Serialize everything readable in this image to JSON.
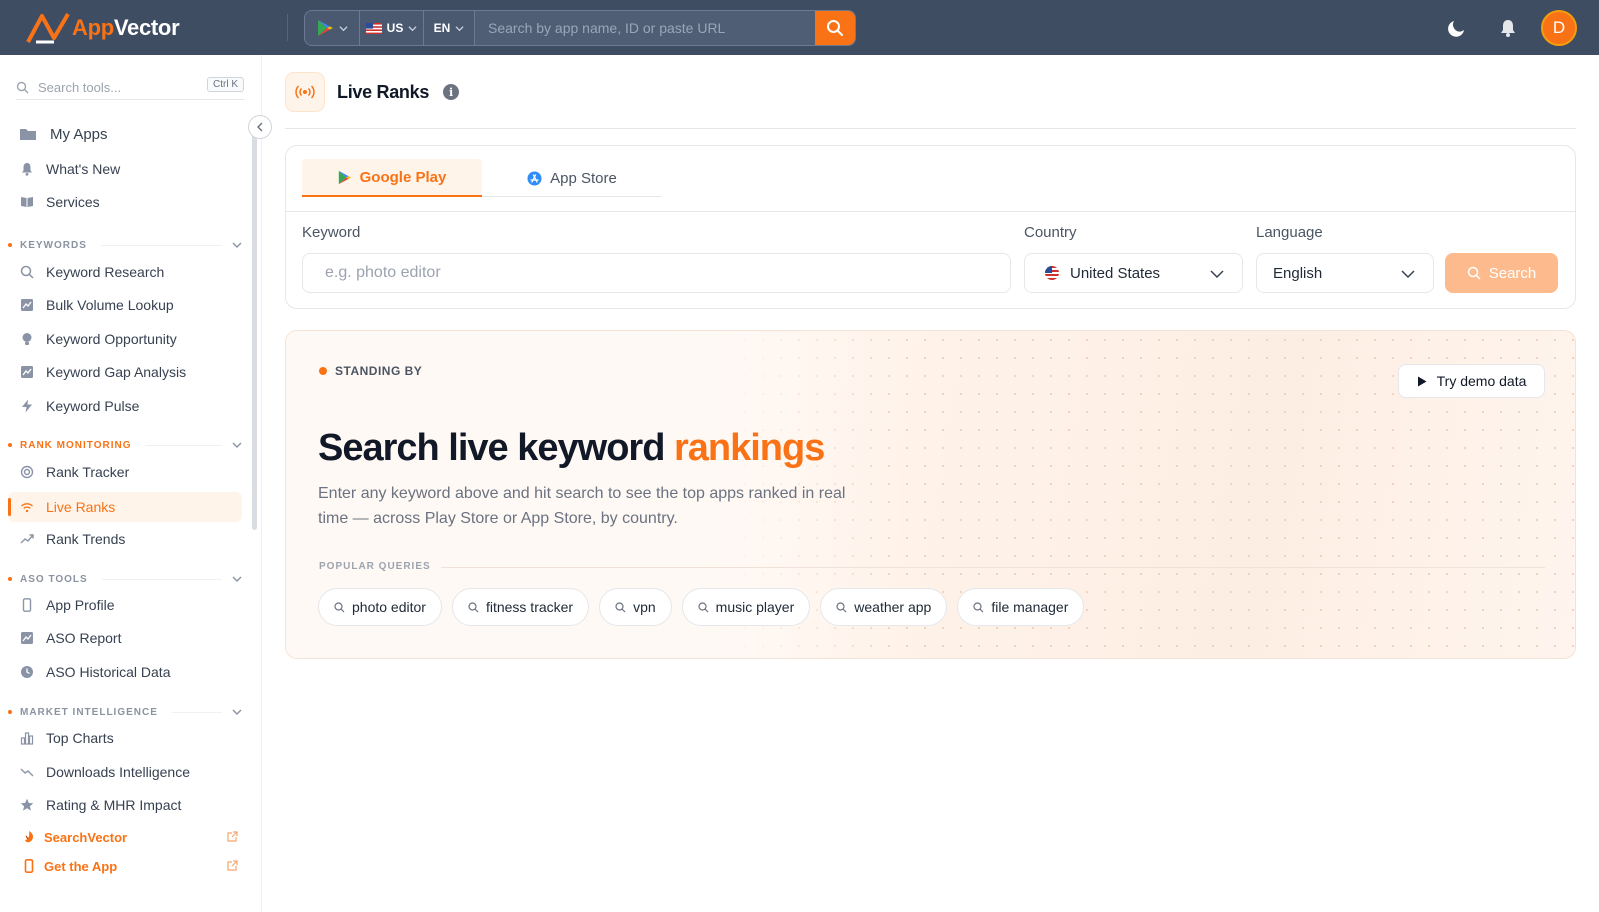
{
  "topbar": {
    "logo_a": "App",
    "logo_b": "Vector",
    "country_code": "US",
    "language_code": "EN",
    "search_placeholder": "Search by app name, ID or paste URL",
    "avatar_initial": "D"
  },
  "sidebar": {
    "search_placeholder": "Search tools...",
    "shortcut": "Ctrl K",
    "top_items": [
      {
        "label": "My Apps",
        "icon": "folder-icon"
      },
      {
        "label": "What's New",
        "icon": "bell-icon"
      },
      {
        "label": "Services",
        "icon": "book-icon"
      }
    ],
    "sections": [
      {
        "title": "KEYWORDS",
        "items": [
          "Keyword Research",
          "Bulk Volume Lookup",
          "Keyword Opportunity",
          "Keyword Gap Analysis",
          "Keyword Pulse"
        ]
      },
      {
        "title": "RANK MONITORING",
        "items": [
          "Rank Tracker",
          "Live Ranks",
          "Rank Trends"
        ]
      },
      {
        "title": "ASO TOOLS",
        "items": [
          "App Profile",
          "ASO Report",
          "ASO Historical Data"
        ]
      },
      {
        "title": "MARKET INTELLIGENCE",
        "items": [
          "Top Charts",
          "Downloads Intelligence",
          "Rating & MHR Impact"
        ]
      }
    ],
    "footer_links": [
      "SearchVector",
      "Get the App"
    ]
  },
  "page": {
    "title": "Live Ranks",
    "tabs": [
      "Google Play",
      "App Store"
    ],
    "keyword_label": "Keyword",
    "keyword_placeholder": "e.g. photo editor",
    "country_label": "Country",
    "country_value": "United States",
    "language_label": "Language",
    "language_value": "English",
    "search_label": "Search"
  },
  "hero": {
    "status": "STANDING BY",
    "demo_label": "Try demo data",
    "title_main": "Search live keyword ",
    "title_accent": "rankings",
    "description": "Enter any keyword above and hit search to see the top apps ranked in real time — across Play Store or App Store, by country.",
    "popular_label": "POPULAR QUERIES",
    "queries": [
      "photo editor",
      "fitness tracker",
      "vpn",
      "music player",
      "weather app",
      "file manager"
    ]
  },
  "colors": {
    "accent": "#f97316",
    "topbar": "#3f4d63",
    "active_bg": "#fff4ea"
  }
}
